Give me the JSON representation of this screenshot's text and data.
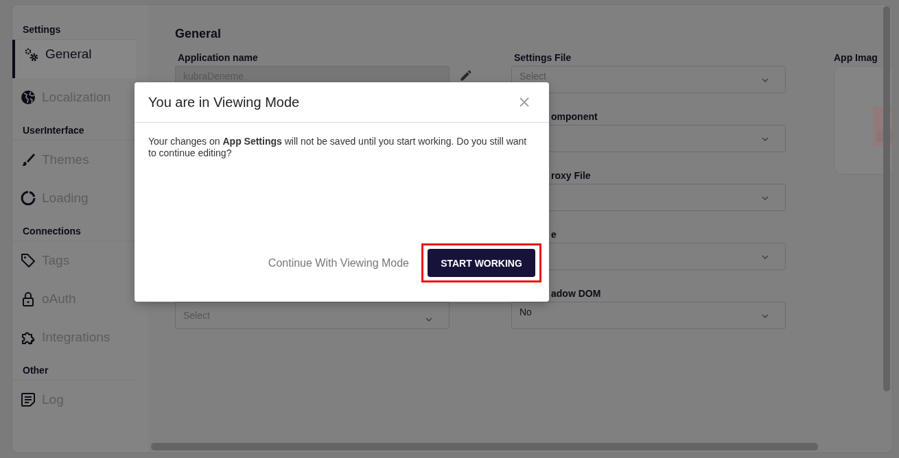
{
  "sidebar": {
    "sections": [
      {
        "title": "Settings",
        "items": [
          {
            "label": "General",
            "selected": true
          },
          {
            "label": "Localization",
            "selected": false
          }
        ]
      },
      {
        "title": "UserInterface",
        "items": [
          {
            "label": "Themes",
            "selected": false
          },
          {
            "label": "Loading",
            "selected": false
          }
        ]
      },
      {
        "title": "Connections",
        "items": [
          {
            "label": "Tags",
            "selected": false
          },
          {
            "label": "oAuth",
            "selected": false
          },
          {
            "label": "Integrations",
            "selected": false
          }
        ]
      },
      {
        "title": "Other",
        "items": [
          {
            "label": "Log",
            "selected": false
          }
        ]
      }
    ]
  },
  "main": {
    "title": "General",
    "left_fields": [
      {
        "label": "Application name",
        "kind": "text",
        "value": "kubraDeneme"
      },
      {
        "kind": "select",
        "placeholder": "Select"
      }
    ],
    "middle_fields": [
      {
        "label": "Settings File",
        "kind": "select",
        "placeholder": "Select"
      },
      {
        "label": "omponent",
        "kind": "select"
      },
      {
        "label": "roxy File",
        "kind": "select"
      },
      {
        "label": "e",
        "kind": "select"
      },
      {
        "label": "adow DOM",
        "kind": "select",
        "value": "No"
      }
    ],
    "image": {
      "label": "App Imag",
      "kind": "picture"
    }
  },
  "dialog": {
    "title": "You are in Viewing Mode",
    "message": "Your changes on **App Settings** will not be saved until you start working. Do you still want to continue editing?",
    "secondary_button": "Continue With Viewing Mode",
    "primary_button": "START WORKING",
    "primary_highlighted": true
  }
}
